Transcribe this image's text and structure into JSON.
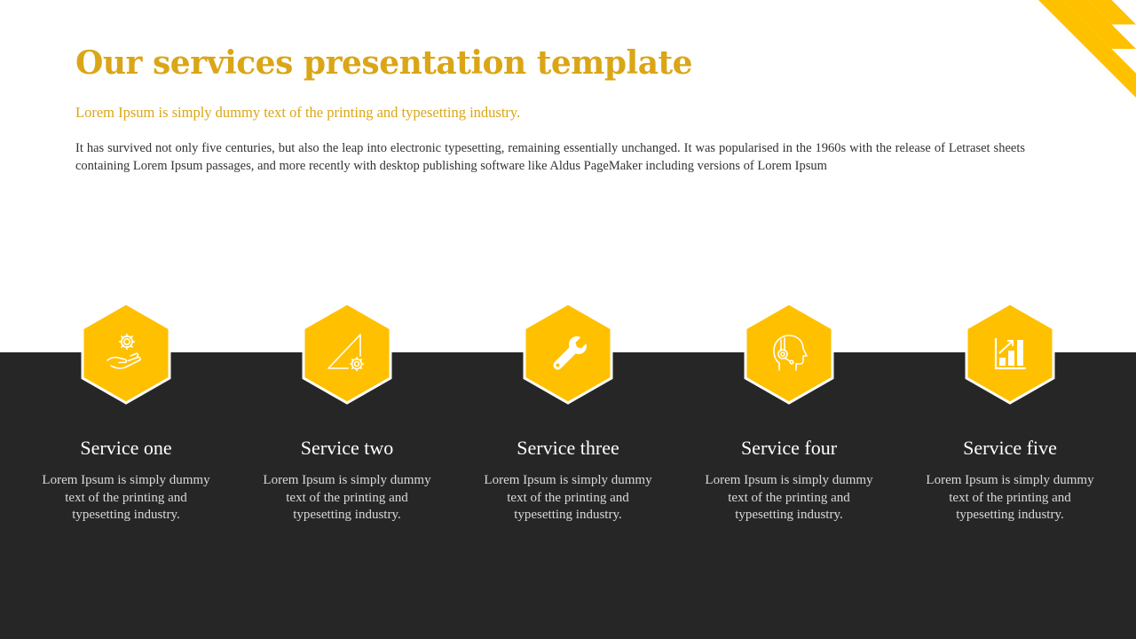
{
  "slide": {
    "title": "Our services presentation template",
    "subtitle": "Lorem Ipsum is simply dummy text of the printing and typesetting industry.",
    "body": "It has survived not only five centuries, but also the leap into electronic typesetting, remaining essentially unchanged. It was popularised in the 1960s with the release of Letraset sheets containing Lorem Ipsum passages, and more recently with desktop publishing software like Aldus PageMaker including versions of Lorem Ipsum"
  },
  "colors": {
    "accent": "#FFC000",
    "title": "#DAA617",
    "dark_band": "#262626",
    "white": "#FFFFFF"
  },
  "services": [
    {
      "title": "Service one",
      "description": "Lorem Ipsum is simply dummy text of the printing and typesetting industry.",
      "icon": "hand-gear-icon"
    },
    {
      "title": "Service two",
      "description": "Lorem Ipsum is simply dummy text of the printing and typesetting industry.",
      "icon": "set-square-gear-icon"
    },
    {
      "title": "Service three",
      "description": "Lorem Ipsum is simply dummy text of the printing and typesetting industry.",
      "icon": "wrench-icon"
    },
    {
      "title": "Service four",
      "description": "Lorem Ipsum is simply dummy text of the printing and typesetting industry.",
      "icon": "headset-support-icon"
    },
    {
      "title": "Service five",
      "description": "Lorem Ipsum is simply dummy text of the printing and typesetting industry.",
      "icon": "bar-chart-growth-icon"
    }
  ]
}
